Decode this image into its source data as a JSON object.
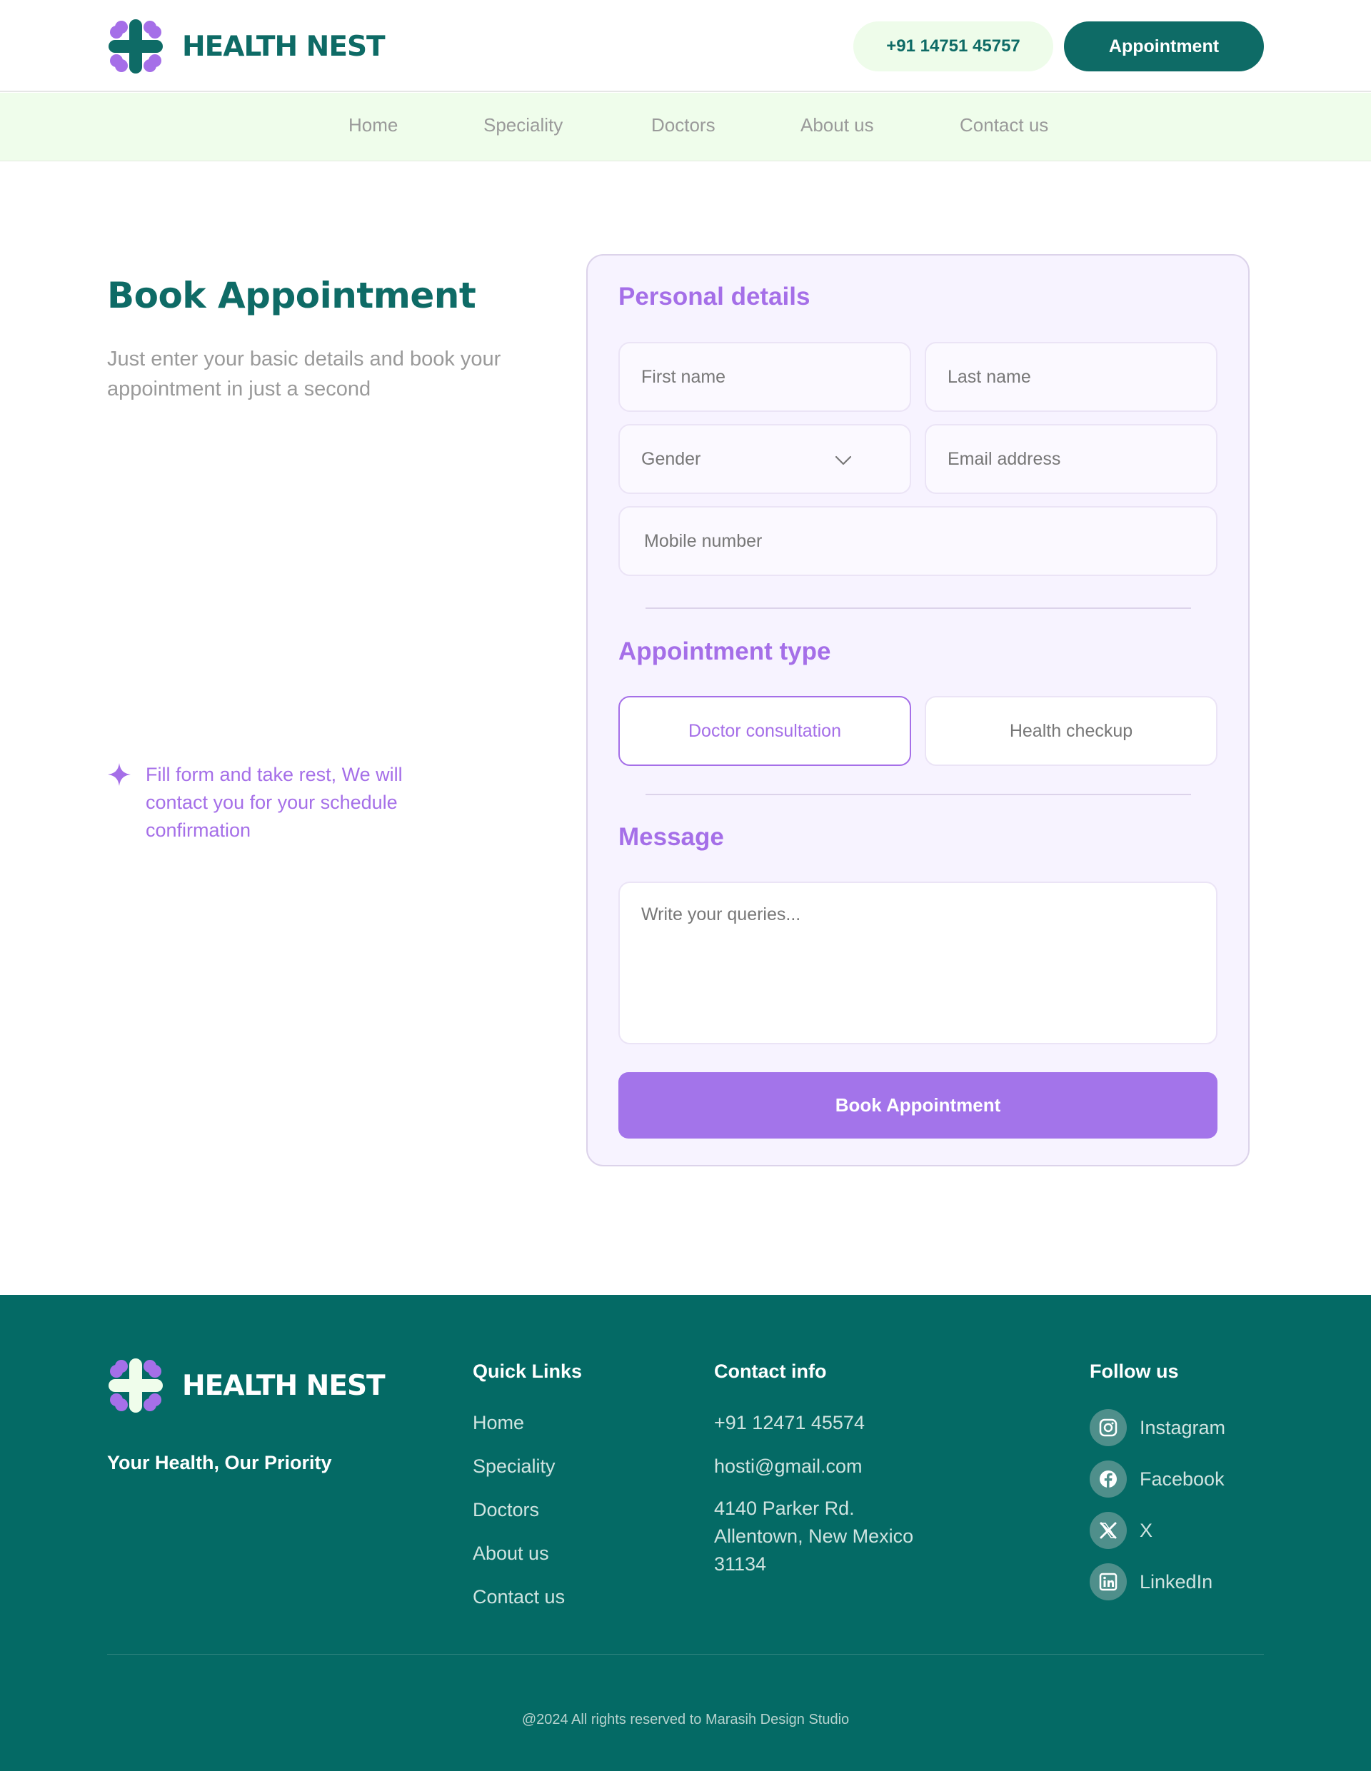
{
  "brand": {
    "name": "HEALTH NEST",
    "primary_color": "#0e6b66",
    "accent_color": "#a56fe8",
    "logo_icon": "health-cross-icon"
  },
  "header": {
    "phone": "+91 14751 45757",
    "appointment_label": "Appointment"
  },
  "nav": {
    "items": [
      "Home",
      "Speciality",
      "Doctors",
      "About us",
      "Contact us"
    ]
  },
  "intro": {
    "title": "Book Appointment",
    "subtitle": "Just enter your basic details and book your appointment in just a second",
    "note": "Fill form and take rest, We will contact you for your schedule confirmation",
    "note_icon": "sparkle-icon"
  },
  "form": {
    "personal": {
      "title": "Personal details",
      "first_name_placeholder": "First name",
      "last_name_placeholder": "Last name",
      "gender_label": "Gender",
      "email_placeholder": "Email address",
      "mobile_placeholder": "Mobile number"
    },
    "appointment_type": {
      "title": "Appointment type",
      "options": [
        "Doctor consultation",
        "Health checkup"
      ],
      "selected": "Doctor consultation"
    },
    "message": {
      "title": "Message",
      "placeholder": "Write your queries..."
    },
    "submit_label": "Book Appointment"
  },
  "footer": {
    "brand_name": "HEALTH NEST",
    "tagline": "Your Health, Our Priority",
    "quick_links": {
      "title": "Quick Links",
      "items": [
        "Home",
        "Speciality",
        "Doctors",
        "About us",
        "Contact us"
      ]
    },
    "contact": {
      "title": "Contact info",
      "phone": "+91 12471 45574",
      "email": "hosti@gmail.com",
      "address": "4140 Parker Rd. Allentown, New Mexico 31134"
    },
    "follow": {
      "title": "Follow us",
      "items": [
        {
          "label": "Instagram",
          "icon": "instagram-icon"
        },
        {
          "label": "Facebook",
          "icon": "facebook-icon"
        },
        {
          "label": "X",
          "icon": "x-icon"
        },
        {
          "label": "LinkedIn",
          "icon": "linkedin-icon"
        }
      ]
    },
    "copyright": "@2024 All rights reserved to Marasih Design Studio",
    "background_color": "#046a65"
  }
}
